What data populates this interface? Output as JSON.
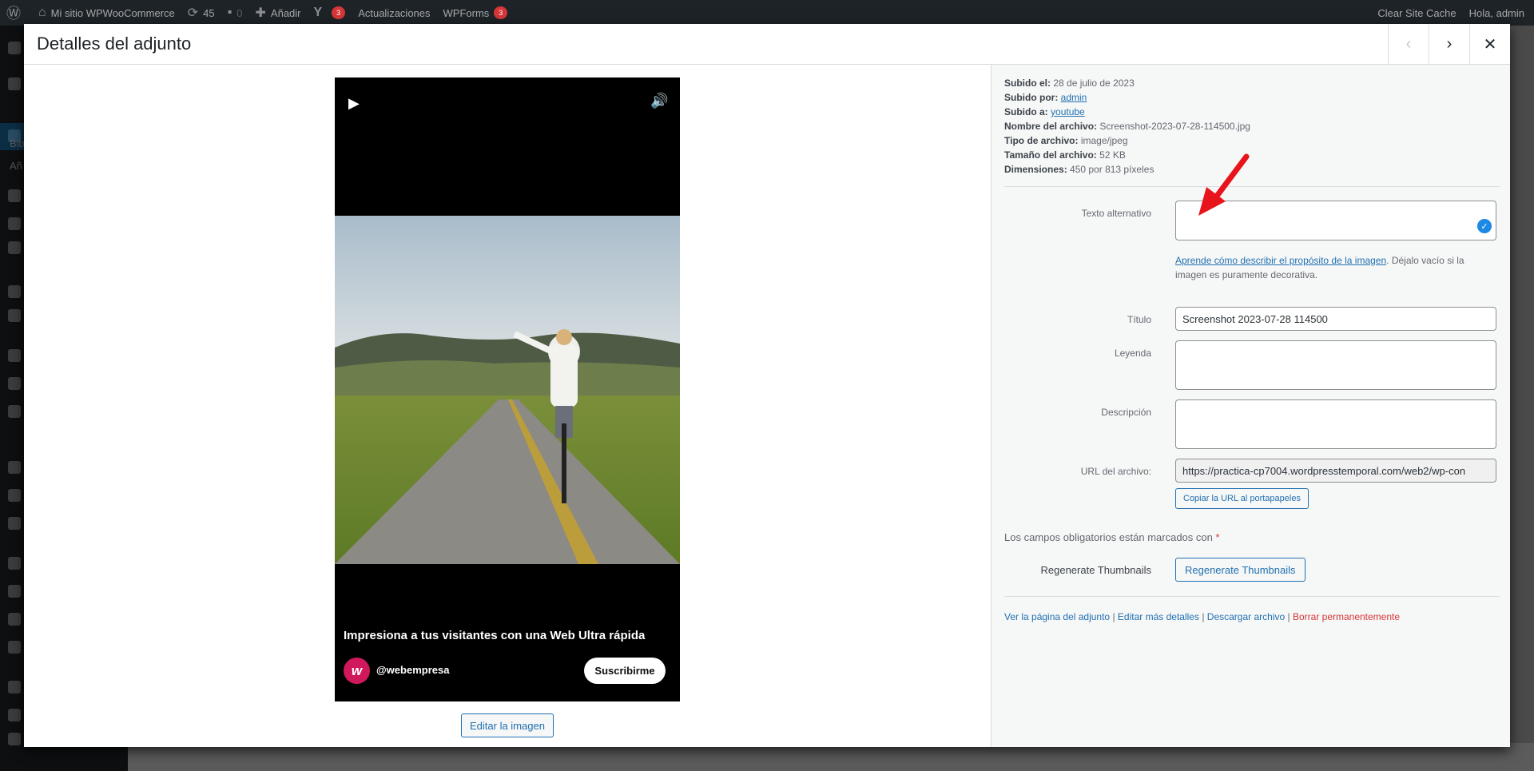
{
  "adminbar": {
    "site_name": "Mi sitio WPWooCommerce",
    "updates_count": "45",
    "comments_count": "0",
    "add_new": "Añadir",
    "yoast_badge": "3",
    "updates": "Actualizaciones",
    "wpforms": "WPForms",
    "wpforms_badge": "3",
    "clear_cache": "Clear Site Cache",
    "greeting": "Hola, admin"
  },
  "left_menu": {
    "sub_items": [
      "Bib",
      "Añ"
    ]
  },
  "modal": {
    "title": "Detalles del adjunto",
    "prev_icon": "chevron-left-icon",
    "next_icon": "chevron-right-icon",
    "close_icon": "close-icon"
  },
  "preview": {
    "video_caption": "Impresiona a tus visitantes con una Web Ultra rápida",
    "channel_logo_letter": "w",
    "channel_name": "@webempresa",
    "subscribe_label": "Suscribirme",
    "edit_image_label": "Editar la imagen"
  },
  "details": {
    "uploaded_on_label": "Subido el:",
    "uploaded_on": "28 de julio de 2023",
    "uploaded_by_label": "Subido por:",
    "uploaded_by": "admin",
    "uploaded_to_label": "Subido a:",
    "uploaded_to": "youtube",
    "file_name_label": "Nombre del archivo:",
    "file_name": "Screenshot-2023-07-28-114500.jpg",
    "file_type_label": "Tipo de archivo:",
    "file_type": "image/jpeg",
    "file_size_label": "Tamaño del archivo:",
    "file_size": "52 KB",
    "dimensions_label": "Dimensiones:",
    "dimensions": "450 por 813 píxeles"
  },
  "form": {
    "alt_label": "Texto alternativo",
    "alt_value": "",
    "alt_help_link": "Aprende cómo describir el propósito de la imagen",
    "alt_help_text": ". Déjalo vacío si la imagen es puramente decorativa.",
    "title_label": "Título",
    "title_value": "Screenshot 2023-07-28 114500",
    "caption_label": "Leyenda",
    "caption_value": "",
    "description_label": "Descripción",
    "description_value": "",
    "url_label": "URL del archivo:",
    "url_value": "https://practica-cp7004.wordpresstemporal.com/web2/wp-con",
    "copy_url_label": "Copiar la URL al portapapeles",
    "required_note": "Los campos obligatorios están marcados con",
    "required_mark": "*",
    "regen_label": "Regenerate Thumbnails",
    "regen_button": "Regenerate Thumbnails"
  },
  "actions": {
    "view_page": "Ver la página del adjunto",
    "edit_more": "Editar más detalles",
    "download": "Descargar archivo",
    "delete": "Borrar permanentemente",
    "separator": "|"
  },
  "colors": {
    "accent": "#2271b1",
    "danger": "#d63638",
    "admin_bar": "#1d2327",
    "annotation_arrow": "#e8141b"
  }
}
